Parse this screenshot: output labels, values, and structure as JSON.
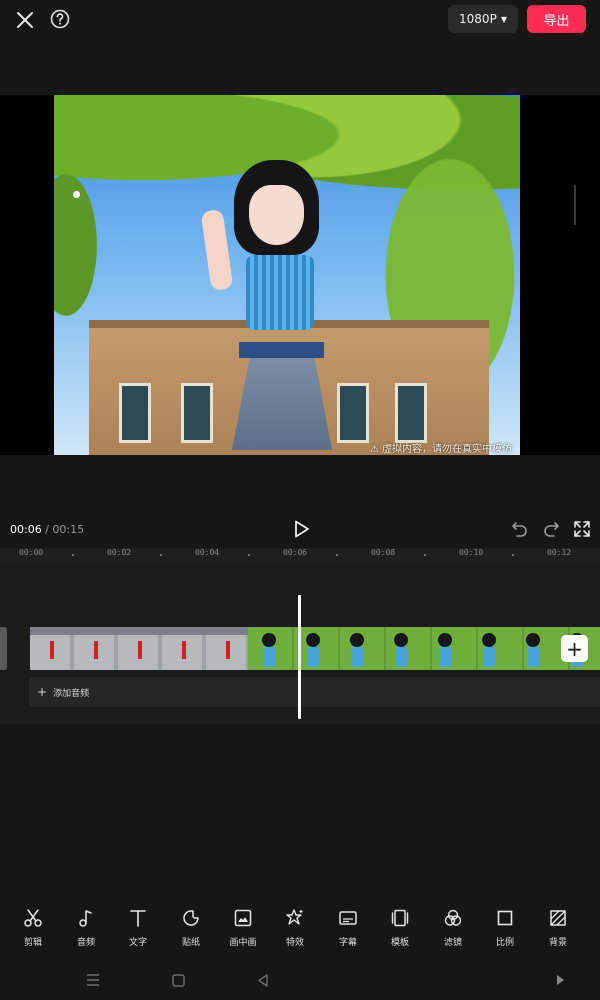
{
  "header": {
    "close_icon": "close-icon",
    "help_icon": "help-icon",
    "resolution": "1080P",
    "export_label": "导出",
    "export_color": "#fe2c55"
  },
  "preview": {
    "watermark": "⚠ 虚拟内容，请勿在真实中模仿"
  },
  "playback": {
    "current_time": "00:06",
    "separator": " / ",
    "total_time": "00:15"
  },
  "ruler": {
    "labels": [
      "00:00",
      "00:02",
      "00:04",
      "00:06",
      "00:08",
      "00:10",
      "00:12"
    ]
  },
  "timeline": {
    "add_audio_label": "添加音频",
    "add_clip_icon": "plus-icon"
  },
  "toolbar": {
    "items": [
      {
        "label": "剪辑",
        "icon": "scissors-icon"
      },
      {
        "label": "音频",
        "icon": "music-note-icon"
      },
      {
        "label": "文字",
        "icon": "text-icon"
      },
      {
        "label": "贴纸",
        "icon": "sticker-icon"
      },
      {
        "label": "画中画",
        "icon": "picture-in-picture-icon"
      },
      {
        "label": "特效",
        "icon": "effects-star-icon"
      },
      {
        "label": "字幕",
        "icon": "subtitle-icon"
      },
      {
        "label": "模板",
        "icon": "template-icon"
      },
      {
        "label": "滤镜",
        "icon": "filter-icon"
      },
      {
        "label": "比例",
        "icon": "ratio-icon"
      },
      {
        "label": "背景",
        "icon": "background-icon"
      }
    ]
  },
  "system_nav": {
    "icons": [
      "menu-icon",
      "home-icon",
      "back-icon",
      "expand-icon"
    ]
  }
}
